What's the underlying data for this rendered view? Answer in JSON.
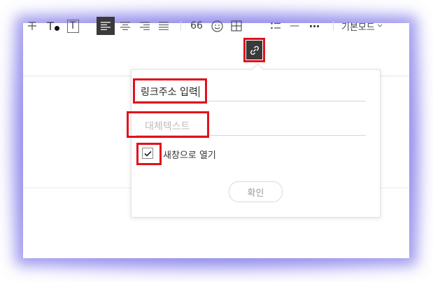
{
  "toolbar": {
    "strike_icon": "strikethrough-icon",
    "text_color_label": "T",
    "text_bg_label": "T",
    "quote_label": "66",
    "emoji_icon": "smiley-icon",
    "table_icon": "table-icon",
    "link_icon": "link-icon",
    "list_icon": "bullet-list-icon",
    "hr_label": "—",
    "more_label": "···",
    "mode_label": "기본모드",
    "accent_color": "#3a3a3a",
    "highlight_color": "#e2111d"
  },
  "link_popup": {
    "url_value": "링크주소 입력",
    "alt_placeholder": "대체텍스트",
    "new_window_label": "새창으로 열기",
    "new_window_checked": true,
    "confirm_label": "확인"
  }
}
